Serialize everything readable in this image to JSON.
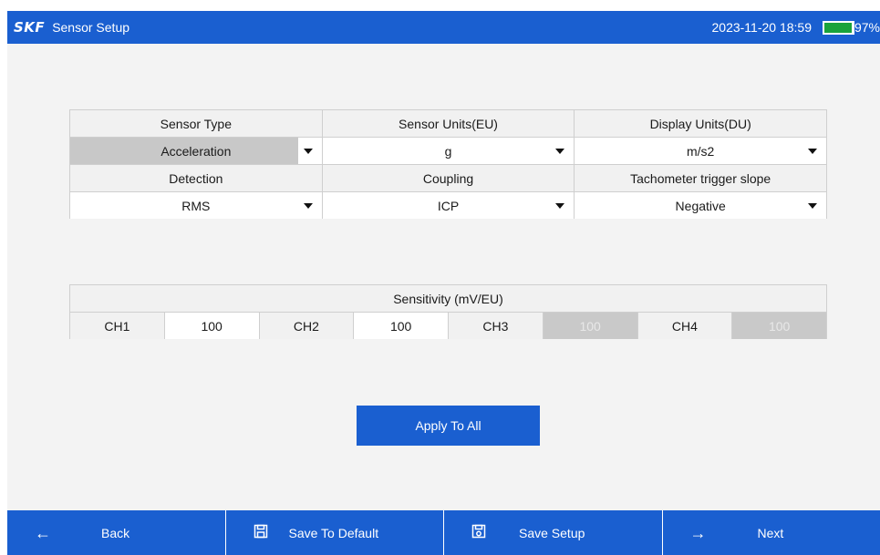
{
  "header": {
    "logo": "SKF",
    "title": "Sensor Setup",
    "datetime": "2023-11-20 18:59",
    "battery": "97%",
    "battery_level": 0.97
  },
  "sensor_table": {
    "row1_headers": [
      "Sensor Type",
      "Sensor Units(EU)",
      "Display Units(DU)"
    ],
    "row1_values": [
      "Acceleration",
      "g",
      "m/s2"
    ],
    "row2_headers": [
      "Detection",
      "Coupling",
      "Tachometer trigger slope"
    ],
    "row2_values": [
      "RMS",
      "ICP",
      "Negative"
    ]
  },
  "sensitivity": {
    "title": "Sensitivity (mV/EU)",
    "channels": [
      {
        "label": "CH1",
        "value": "100"
      },
      {
        "label": "CH2",
        "value": "100"
      },
      {
        "label": "CH3",
        "value": "100"
      },
      {
        "label": "CH4",
        "value": "100"
      }
    ]
  },
  "apply_label": "Apply To All",
  "footer": {
    "back": "Back",
    "save_default": "Save To Default",
    "save_setup": "Save Setup",
    "next": "Next"
  },
  "colors": {
    "brand_blue": "#1a5fd0",
    "battery_green": "#1aa33c"
  }
}
